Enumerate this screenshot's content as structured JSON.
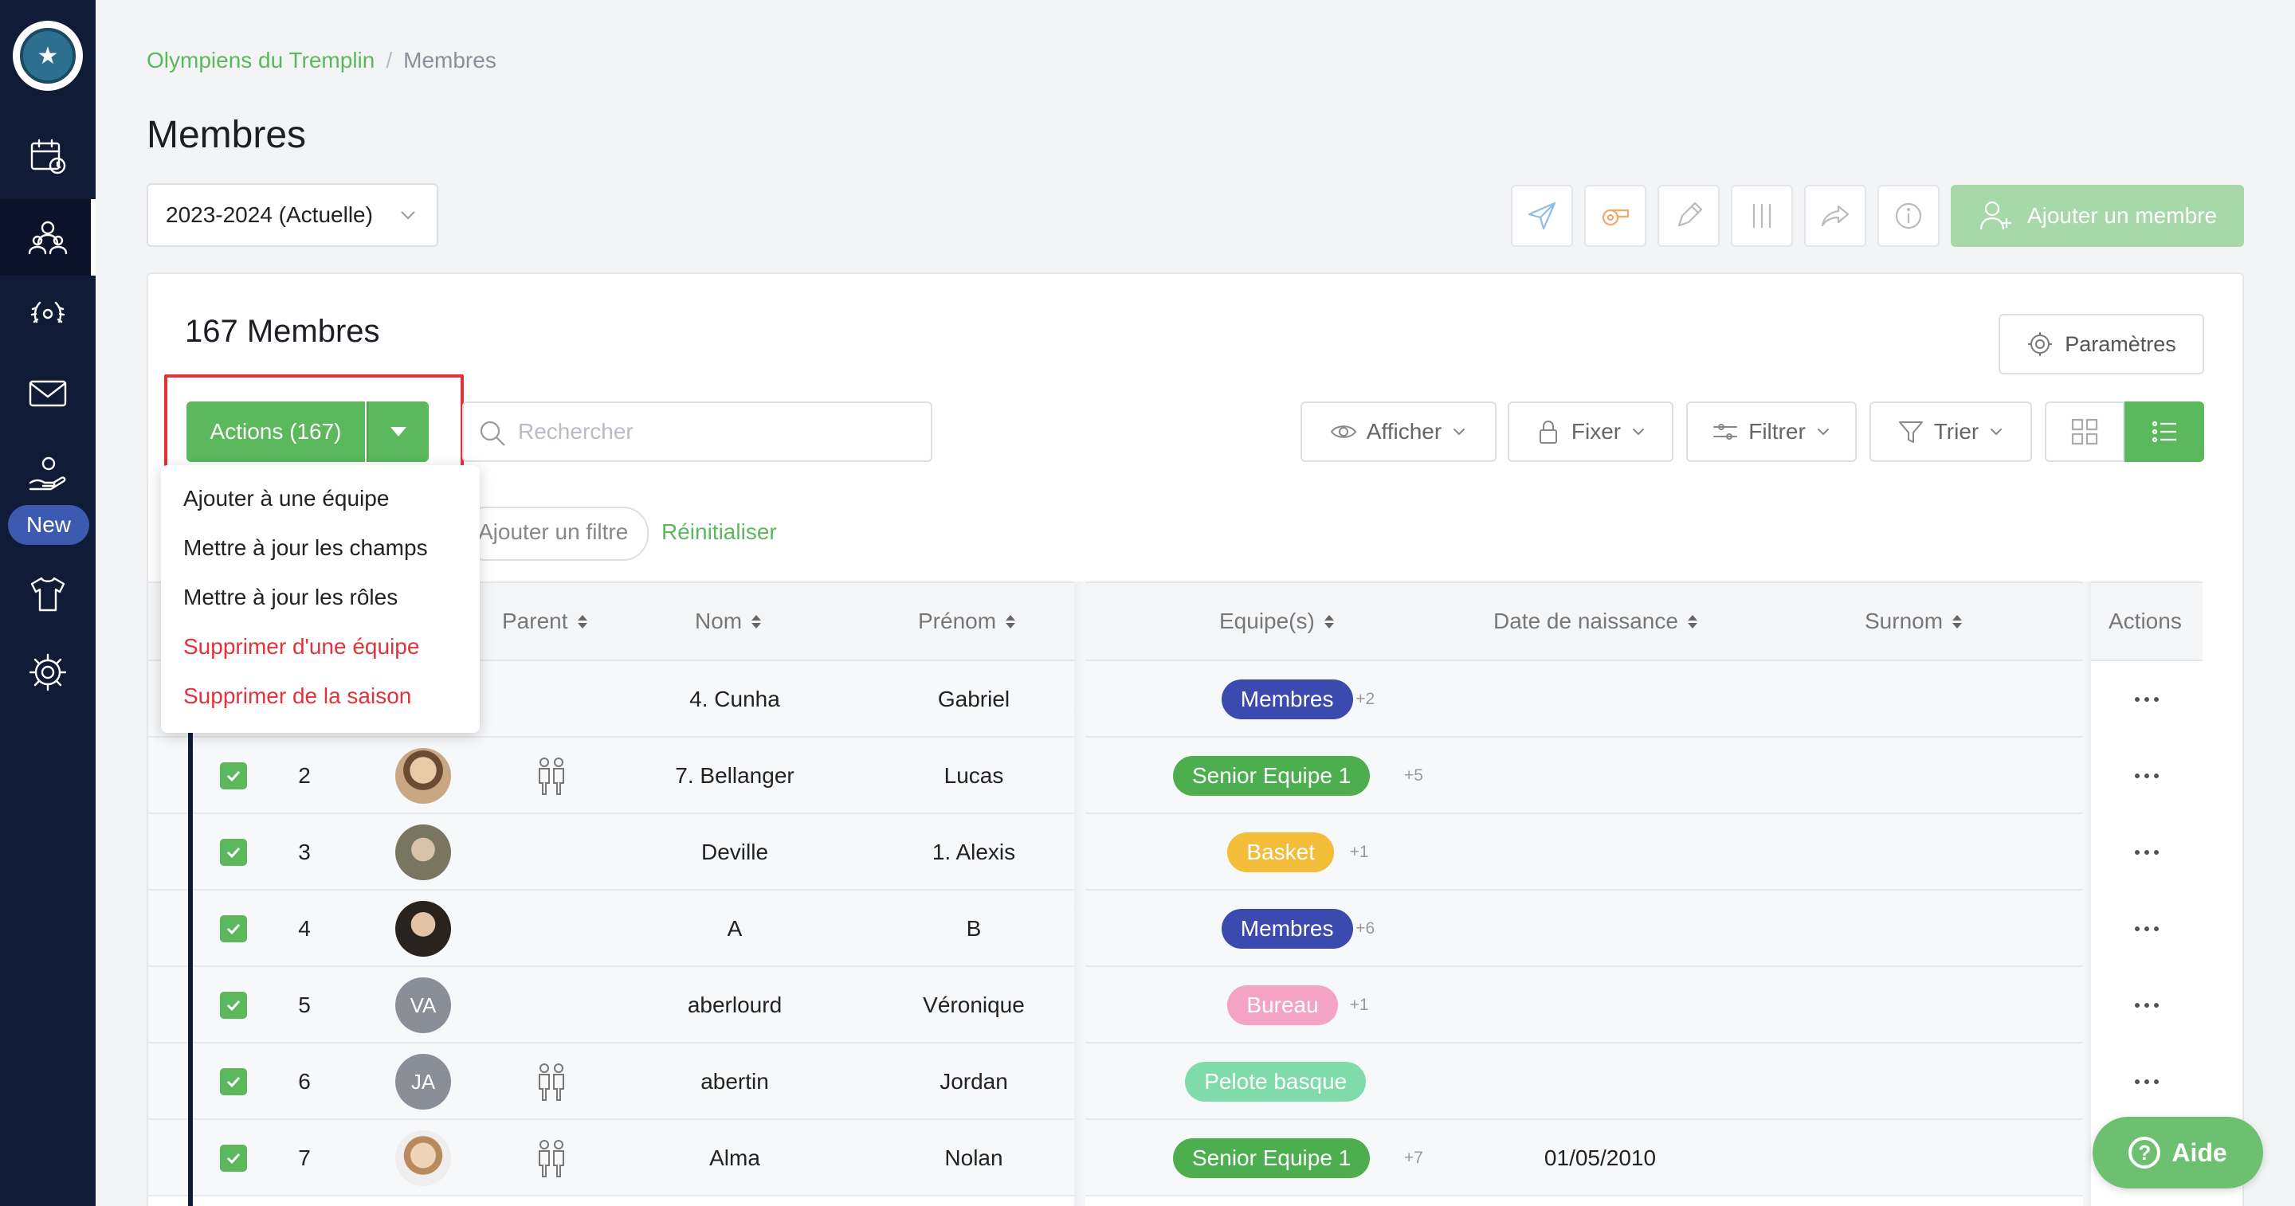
{
  "breadcrumb": {
    "club": "Olympiens du Tremplin",
    "sep": "/",
    "current": "Membres"
  },
  "page": {
    "title": "Membres"
  },
  "season": {
    "selected": "2023-2024 (Actuelle)"
  },
  "toolbar": {
    "add_member_label": "Ajouter un membre"
  },
  "panel": {
    "count_title": "167 Membres",
    "params_label": "Paramètres",
    "actions_label": "Actions (167)",
    "search_placeholder": "Rechercher",
    "afficher": "Afficher",
    "fixer": "Fixer",
    "filtrer": "Filtrer",
    "trier": "Trier",
    "add_filter": "Ajouter un filtre",
    "reset": "Réinitialiser"
  },
  "dropdown": {
    "items": [
      "Ajouter à une équipe",
      "Mettre à jour les champs",
      "Mettre à jour les rôles",
      "Supprimer d'une équipe",
      "Supprimer de la saison"
    ]
  },
  "sidebar": {
    "new_badge": "New"
  },
  "table": {
    "headers": {
      "parent": "Parent",
      "nom": "Nom",
      "prenom": "Prénom",
      "equipes": "Equipe(s)",
      "naissance": "Date de naissance",
      "surnom": "Surnom",
      "actions": "Actions"
    },
    "rows": [
      {
        "num": "",
        "nom": "4. Cunha",
        "prenom": "Gabriel",
        "team": "Membres",
        "team_color": "#3b4aaf",
        "more": "+2",
        "birth": "",
        "avatar": ""
      },
      {
        "num": "2",
        "nom": "7. Bellanger",
        "prenom": "Lucas",
        "team": "Senior Equipe 1",
        "team_color": "#4cae4f",
        "more": "+5",
        "birth": "",
        "avatar": ""
      },
      {
        "num": "3",
        "nom": "Deville",
        "prenom": "1. Alexis",
        "team": "Basket",
        "team_color": "#f3bd3a",
        "more": "+1",
        "birth": "",
        "avatar": ""
      },
      {
        "num": "4",
        "nom": "A",
        "prenom": "B",
        "team": "Membres",
        "team_color": "#3b4aaf",
        "more": "+6",
        "birth": "",
        "avatar": ""
      },
      {
        "num": "5",
        "nom": "aberlourd",
        "prenom": "Véronique",
        "team": "Bureau",
        "team_color": "#f4a3c4",
        "more": "+1",
        "birth": "",
        "avatar": "VA"
      },
      {
        "num": "6",
        "nom": "abertin",
        "prenom": "Jordan",
        "team": "Pelote basque",
        "team_color": "#7fdcaa",
        "more": "",
        "birth": "",
        "avatar": "JA"
      },
      {
        "num": "7",
        "nom": "Alma",
        "prenom": "Nolan",
        "team": "Senior Equipe 1",
        "team_color": "#4cae4f",
        "more": "+7",
        "birth": "01/05/2010",
        "avatar": ""
      }
    ]
  },
  "help": {
    "label": "Aide"
  }
}
